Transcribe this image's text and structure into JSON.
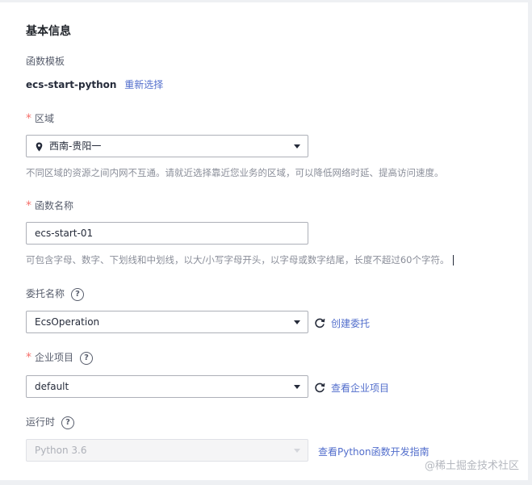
{
  "section": {
    "title": "基本信息"
  },
  "template": {
    "label": "函数模板",
    "value": "ecs-start-python",
    "reselect_link": "重新选择"
  },
  "region": {
    "required_mark": "*",
    "label": "区域",
    "value": "西南-贵阳一",
    "icon": "location-pin-icon",
    "hint": "不同区域的资源之间内网不互通。请就近选择靠近您业务的区域，可以降低网络时延、提高访问速度。"
  },
  "function_name": {
    "required_mark": "*",
    "label": "函数名称",
    "value": "ecs-start-01",
    "hint": "可包含字母、数字、下划线和中划线，以大/小写字母开头，以字母或数字结尾，长度不超过60个字符。"
  },
  "agency": {
    "label": "委托名称",
    "help": "?",
    "value": "EcsOperation",
    "create_link": "创建委托"
  },
  "enterprise_project": {
    "required_mark": "*",
    "label": "企业项目",
    "help": "?",
    "value": "default",
    "view_link": "查看企业项目"
  },
  "runtime": {
    "label": "运行时",
    "help": "?",
    "value": "Python 3.6",
    "guide_link": "查看Python函数开发指南"
  },
  "watermark": "@稀土掘金技术社区",
  "colors": {
    "link": "#526ecc",
    "required": "#f66f6a",
    "hint": "#8a8e99"
  }
}
